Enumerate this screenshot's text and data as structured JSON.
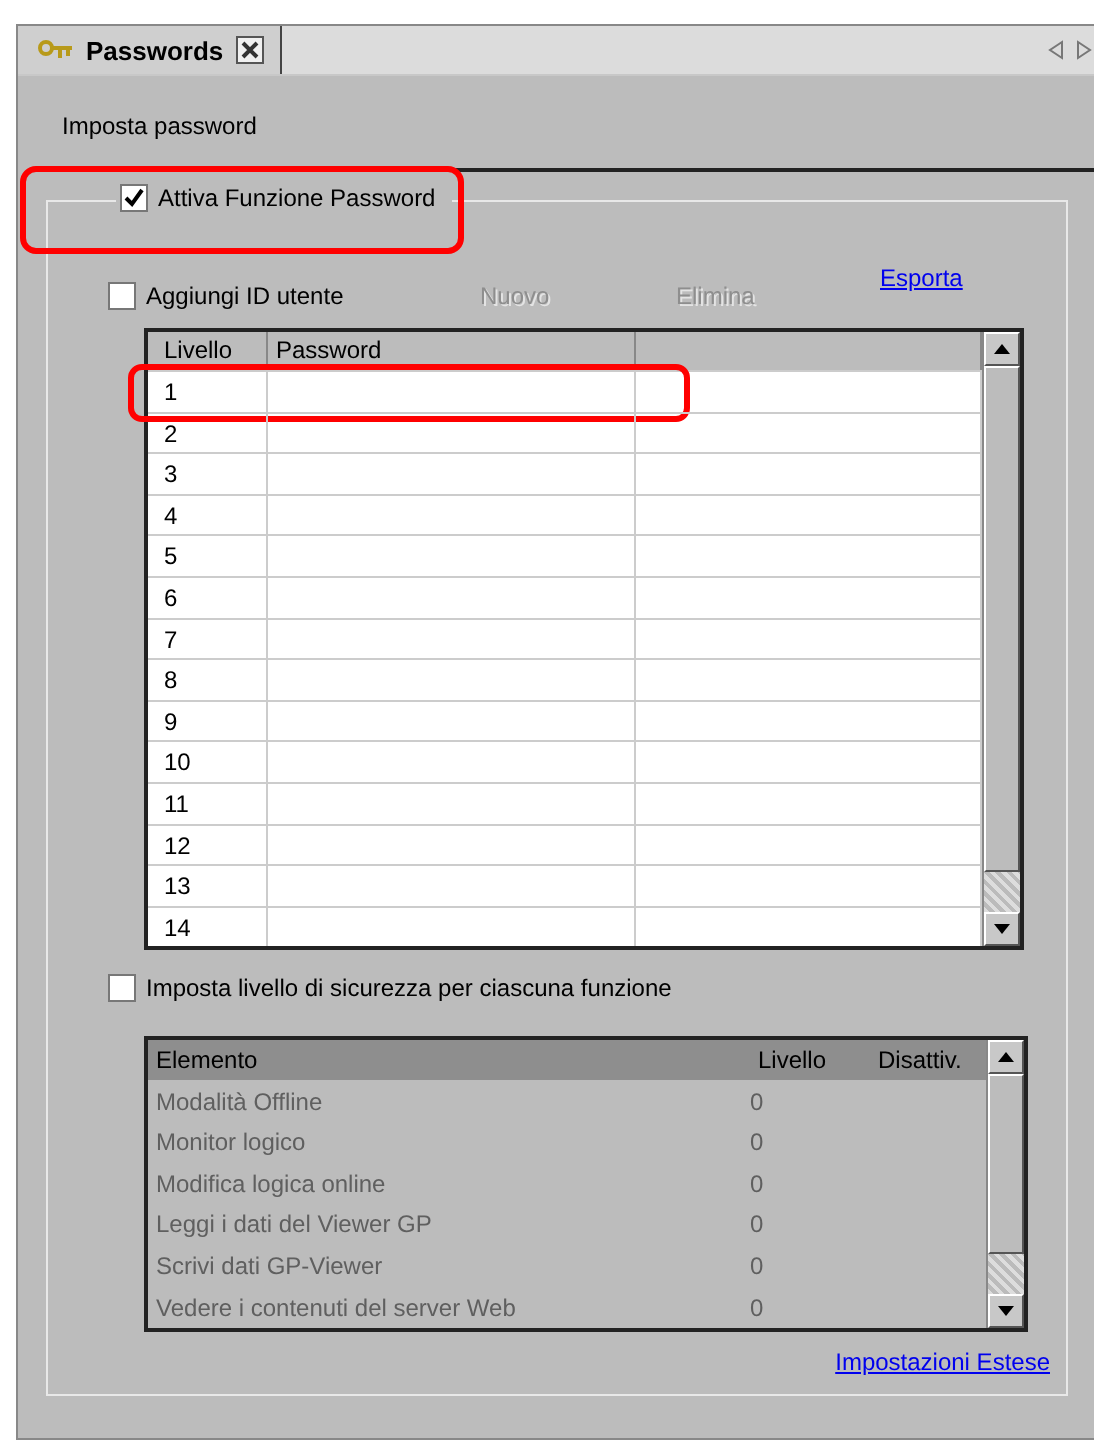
{
  "tab": {
    "label": "Passwords",
    "selected": true
  },
  "section_title": "Imposta password",
  "enable_password": {
    "label": "Attiva Funzione Password",
    "checked": true,
    "highlighted": true
  },
  "user_id": {
    "label": "Aggiungi ID utente",
    "checked": false
  },
  "buttons": [
    {
      "label": "Nuovo",
      "disabled": true
    },
    {
      "label": "Elimina",
      "disabled": true
    }
  ],
  "export_link": "Esporta",
  "password_table": {
    "columns": [
      "Livello",
      "Password"
    ],
    "rows": [
      {
        "level": "1",
        "highlighted": true
      },
      {
        "level": "2",
        "highlighted": false
      },
      {
        "level": "3",
        "highlighted": false
      },
      {
        "level": "4",
        "highlighted": false
      },
      {
        "level": "5",
        "highlighted": false
      },
      {
        "level": "6",
        "highlighted": false
      },
      {
        "level": "7",
        "highlighted": false
      },
      {
        "level": "8",
        "highlighted": false
      },
      {
        "level": "9",
        "highlighted": false
      },
      {
        "level": "10",
        "highlighted": false
      },
      {
        "level": "11",
        "highlighted": false
      },
      {
        "level": "12",
        "highlighted": false
      },
      {
        "level": "13",
        "highlighted": false
      },
      {
        "level": "14",
        "highlighted": false
      }
    ]
  },
  "function_security": {
    "label": "Imposta livello di sicurezza per ciascuna funzione",
    "checked": false
  },
  "function_table": {
    "columns": [
      "Elemento",
      "Livello",
      "Disattiv."
    ],
    "disabled": true,
    "rows": [
      {
        "element": "Modalità Offline",
        "level": "0"
      },
      {
        "element": "Monitor logico",
        "level": "0"
      },
      {
        "element": "Modifica logica online",
        "level": "0"
      },
      {
        "element": "Leggi i dati del Viewer GP",
        "level": "0"
      },
      {
        "element": "Scrivi dati GP-Viewer",
        "level": "0"
      },
      {
        "element": "Vedere i contenuti del server Web",
        "level": "0"
      }
    ]
  },
  "extended_link": "Impostazioni Estese"
}
